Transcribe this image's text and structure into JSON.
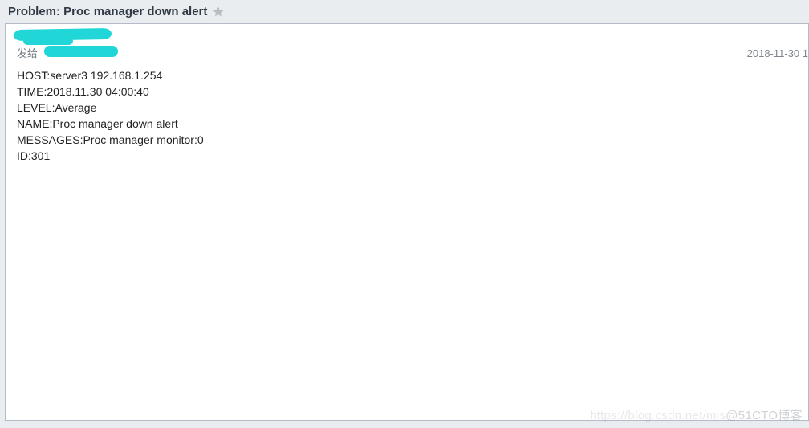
{
  "header": {
    "title": "Problem: Proc manager down alert"
  },
  "message": {
    "to_label": "发给",
    "date": "2018-11-30 1",
    "body": {
      "host_label": "HOST:",
      "host_value": "server3 192.168.1.254",
      "time_label": "TIME:",
      "time_value": "2018.11.30 04:00:40",
      "level_label": "LEVEL:",
      "level_value": "Average",
      "name_label": "NAME:",
      "name_value": "Proc manager down alert",
      "messages_label": "MESSAGES:",
      "messages_value": "Proc manager monitor:0",
      "id_label": "ID:",
      "id_value": "301"
    }
  },
  "watermark": {
    "faint": "https://blog.csdn.net/mis",
    "main": "@51CTO博客"
  }
}
